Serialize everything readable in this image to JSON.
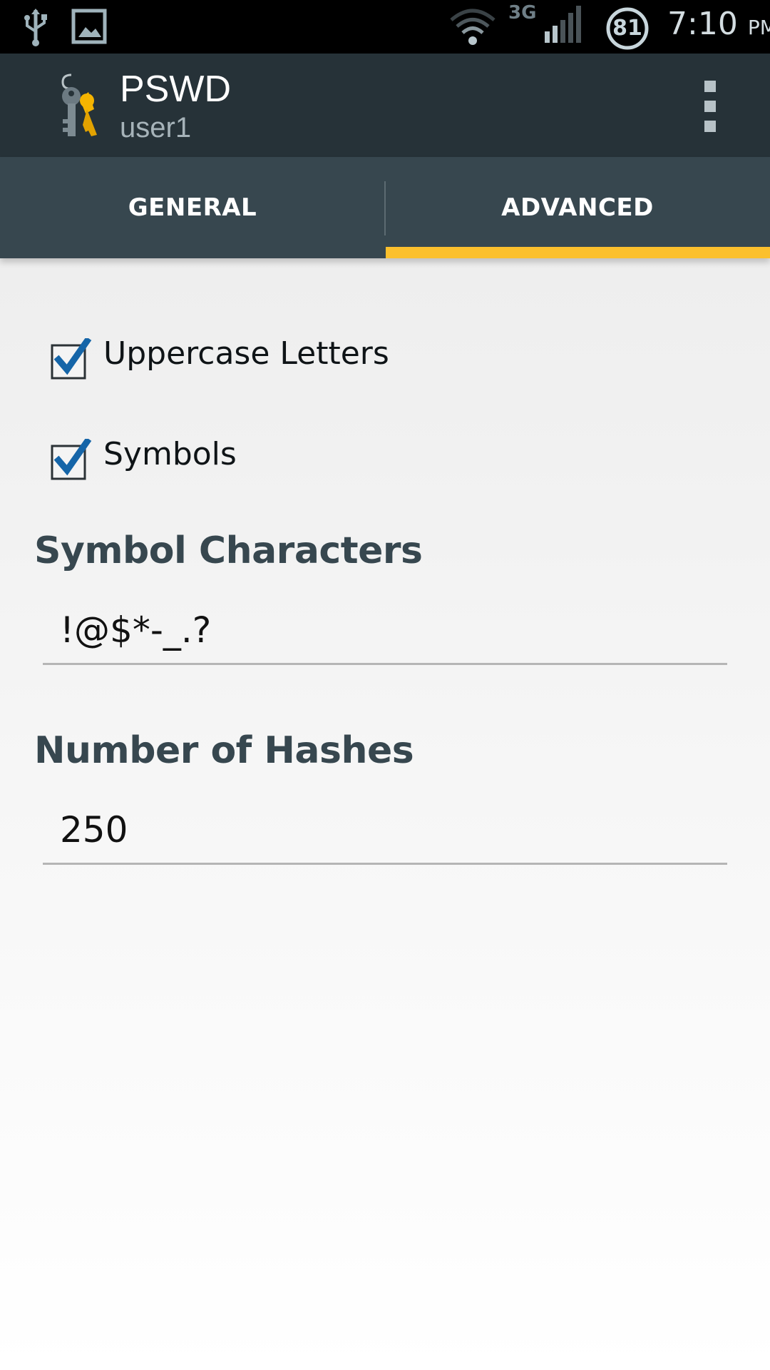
{
  "status_bar": {
    "usb_icon": "usb-icon",
    "image_icon": "image-notification-icon",
    "wifi_icon": "wifi-icon",
    "network_type": "3G",
    "signal_icon": "cell-signal-icon",
    "battery_level": "81",
    "time": "7:10",
    "ampm": "PM"
  },
  "app_bar": {
    "icon": "keys-icon",
    "title": "PSWD",
    "subtitle": "user1",
    "overflow_icon": "overflow-menu-icon"
  },
  "tabs": [
    {
      "label": "GENERAL",
      "selected": false
    },
    {
      "label": "ADVANCED",
      "selected": true
    }
  ],
  "options": {
    "uppercase": {
      "label": "Uppercase Letters",
      "checked": true
    },
    "symbols": {
      "label": "Symbols",
      "checked": true
    }
  },
  "symbol_characters": {
    "heading": "Symbol Characters",
    "value": "!@$*-_.?"
  },
  "number_of_hashes": {
    "heading": "Number of Hashes",
    "value": "250"
  },
  "colors": {
    "status_bar": "#000000",
    "app_bar": "#263238",
    "tab_bar": "#37474f",
    "tab_indicator": "#fbc02d",
    "heading": "#37474f",
    "checkbox_check": "#1565a8"
  }
}
